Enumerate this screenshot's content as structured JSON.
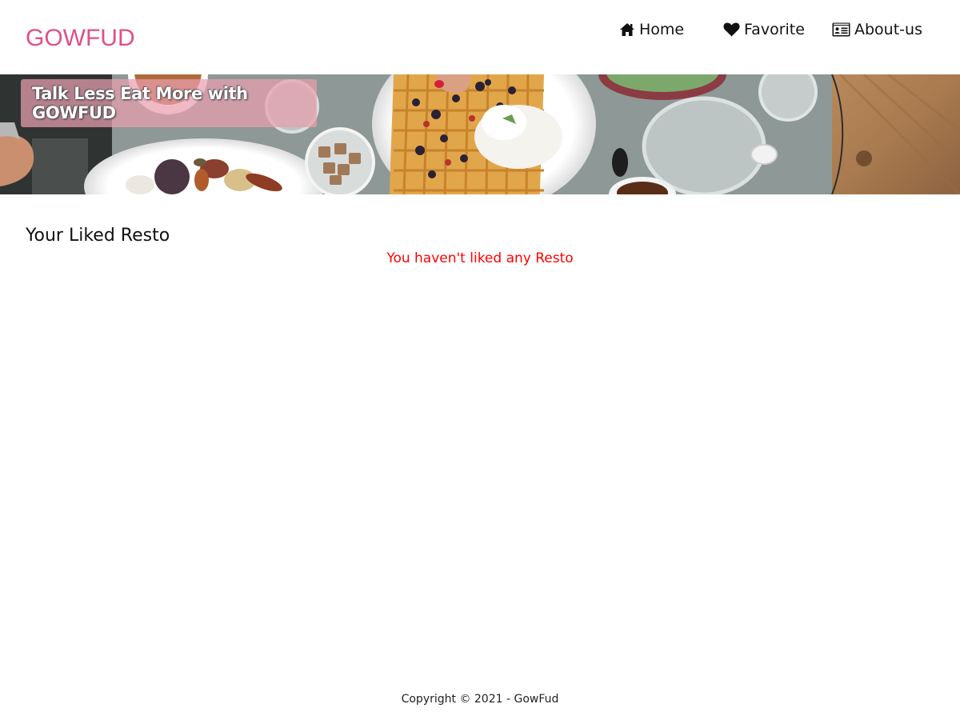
{
  "header": {
    "brand": "GOWFUD",
    "nav": {
      "home_label": "Home",
      "favorite_label": "Favorite",
      "about_label": "About-us"
    },
    "icons": {
      "home": "home-icon",
      "favorite": "heart-icon",
      "about": "id-card-icon"
    }
  },
  "hero": {
    "tagline": "Talk Less Eat More with GOWFUD"
  },
  "main": {
    "section_title": "Your Liked Resto",
    "empty_message": "You haven't liked any Resto"
  },
  "footer": {
    "copyright": "Copyright © 2021 - GowFud"
  },
  "colors": {
    "brand": "#e0508a",
    "empty_message": "#ff0000",
    "tagline_bg": "#e9a0af"
  }
}
